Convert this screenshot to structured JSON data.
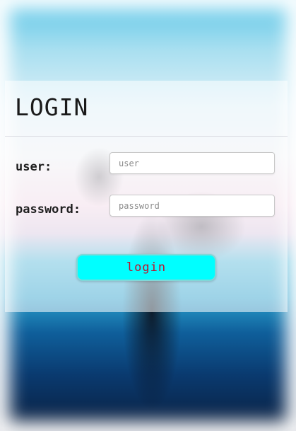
{
  "form": {
    "title": "LOGIN",
    "user_label": "user:",
    "user_placeholder": "user",
    "password_label": "password:",
    "password_placeholder": "password",
    "login_label": "login"
  },
  "colors": {
    "button_bg": "#00ffff",
    "button_text": "#c0102a"
  }
}
